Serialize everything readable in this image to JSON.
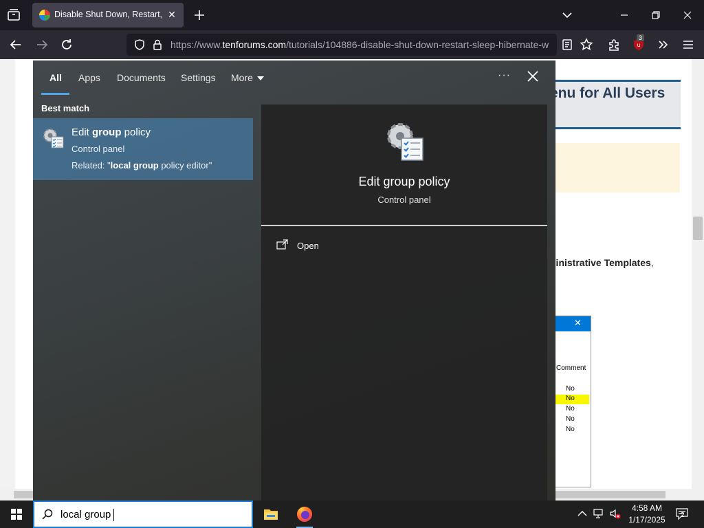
{
  "browser": {
    "tab": {
      "title": "Disable Shut Down, Restart, Sleep, Hibernate",
      "close": "✕"
    },
    "url": {
      "prefix": "https://www.",
      "domain": "tenforums.com",
      "path": "/tutorials/104886-disable-shut-down-restart-sleep-hibernate-w"
    },
    "extension_badge": "3"
  },
  "page_bg": {
    "heading": "enu for All Users",
    "line_bold": "ninistrative Templates",
    "line_rest": ",",
    "shot": {
      "close": "✕",
      "column_header": "Comment",
      "rows": [
        "No",
        "No",
        "No",
        "No",
        "No"
      ]
    }
  },
  "search": {
    "tabs": [
      {
        "label": "All",
        "active": true
      },
      {
        "label": "Apps"
      },
      {
        "label": "Documents"
      },
      {
        "label": "Settings"
      },
      {
        "label": "More"
      }
    ],
    "dots": "···",
    "best_match_label": "Best match",
    "result": {
      "title_pre": "Edit ",
      "title_bold": "group",
      "title_post": " policy",
      "subtitle": "Control panel",
      "related_pre": "Related: \"",
      "related_bold": "local group",
      "related_post": " policy editor\""
    },
    "detail": {
      "title": "Edit group policy",
      "subtitle": "Control panel",
      "action_open": "Open"
    }
  },
  "taskbar": {
    "search_value": "local group",
    "clock_time": "4:58 AM",
    "clock_date": "1/17/2025",
    "notification_count": "2"
  }
}
